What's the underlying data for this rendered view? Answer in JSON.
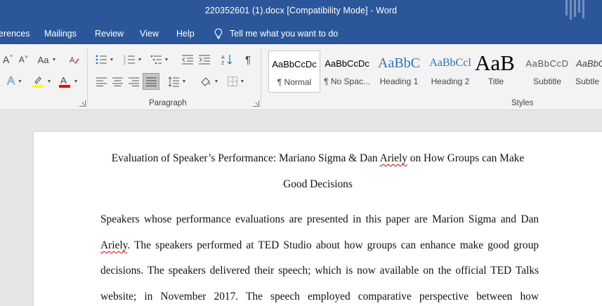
{
  "window": {
    "title": "220352601 (1).docx [Compatibility Mode]  -  Word"
  },
  "menu": {
    "tabs": [
      "erences",
      "Mailings",
      "Review",
      "View",
      "Help"
    ],
    "tell_me": "Tell me what you want to do"
  },
  "ribbon": {
    "font_group": {
      "case_label": "Aa"
    },
    "paragraph_group_label": "Paragraph",
    "styles_group_label": "Styles",
    "styles": [
      {
        "preview": "AaBbCcDc",
        "name": "¶ Normal",
        "active": true
      },
      {
        "preview": "AaBbCcDc",
        "name": "¶ No Spac..."
      },
      {
        "preview": "AaBbC",
        "name": "Heading 1"
      },
      {
        "preview": "AaBbCcl",
        "name": "Heading 2"
      },
      {
        "preview": "AaB",
        "name": "Title"
      },
      {
        "preview": "AaBbCcD",
        "name": "Subtitle"
      },
      {
        "preview": "AaBbC",
        "name": "Subtle"
      }
    ],
    "colors": {
      "highlight": "#ffff00",
      "font_color": "#ff0000",
      "heading_blue": "#2e74b5"
    }
  },
  "document": {
    "heading": {
      "line1_a": "Evaluation of Speaker’s Performance: Mariano Sigma & Dan ",
      "line1_b": "Ariely",
      "line1_c": " on How Groups can Make",
      "line2": "Good Decisions"
    },
    "paragraph": {
      "line1": "Speakers whose performance evaluations are presented in this paper are Marion Sigma and Dan",
      "line2_a": "Ariely",
      "line2_b": ". The speakers performed at TED Studio about how groups can enhance make good group",
      "line3": "decisions. The speakers delivered their speech; which is now available on the official TED Talks",
      "line4": "website; in November 2017. The speech employed comparative perspective between how"
    }
  }
}
